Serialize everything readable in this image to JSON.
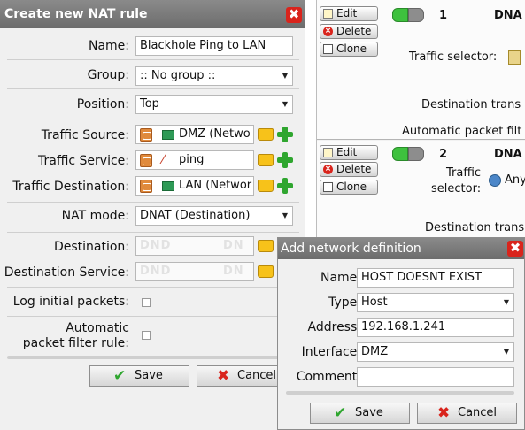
{
  "nat_dialog": {
    "title": "Create new NAT rule",
    "close_symbol": "✖",
    "name_label": "Name:",
    "name_value": "Blackhole Ping to LAN",
    "group_label": "Group:",
    "group_value": ":: No group ::",
    "position_label": "Position:",
    "position_value": "Top",
    "traffic_source_label": "Traffic Source:",
    "traffic_source_value": "DMZ (Netwo",
    "traffic_service_label": "Traffic Service:",
    "traffic_service_value": "ping",
    "traffic_destination_label": "Traffic Destination:",
    "traffic_destination_value": "LAN (Networ",
    "nat_mode_label": "NAT mode:",
    "nat_mode_value": "DNAT (Destination)",
    "destination_label": "Destination:",
    "destination_placeholder_1": "DND",
    "destination_placeholder_2": "DN",
    "destination_service_label": "Destination Service:",
    "destination_service_placeholder_1": "DND",
    "destination_service_placeholder_2": "DN",
    "log_label": "Log initial packets:",
    "auto_filter_label_1": "Automatic",
    "auto_filter_label_2": "packet filter rule:",
    "save_label": "Save",
    "cancel_label": "Cancel"
  },
  "rules_list": {
    "edit_label": "Edit",
    "delete_label": "Delete",
    "clone_label": "Clone",
    "rule1": {
      "number": "1",
      "type": "DNA",
      "traffic_selector": "Traffic selector:",
      "destination_trans": "Destination trans",
      "auto_packet_filter": "Automatic packet filt"
    },
    "rule2": {
      "number": "2",
      "type": "DNA",
      "traffic_label_1": "Traffic",
      "traffic_label_2": "selector:",
      "any_text": "Any",
      "destination_trans": "Destination trans"
    }
  },
  "net_dialog": {
    "title": "Add network definition",
    "close_symbol": "✖",
    "name_label": "Name:",
    "name_value": "HOST DOESNT EXIST",
    "type_label": "Type:",
    "type_value": "Host",
    "address_label": "Address:",
    "address_value": "192.168.1.241",
    "interface_label": "Interface:",
    "interface_value": "DMZ",
    "comment_label": "Comment:",
    "comment_value": "",
    "save_label": "Save",
    "cancel_label": "Cancel"
  },
  "colors": {
    "title_bar": "#7a7a7a",
    "close_red": "#d9241c",
    "toggle_green": "#3ec13e",
    "add_green": "#2fa62f",
    "folder_yellow": "#f7c21a"
  },
  "icons": {
    "edit": "edit-icon",
    "delete": "delete-icon",
    "clone": "clone-icon",
    "folder": "folder-icon",
    "add": "plus-icon",
    "check": "check-icon",
    "cancel": "x-icon"
  }
}
